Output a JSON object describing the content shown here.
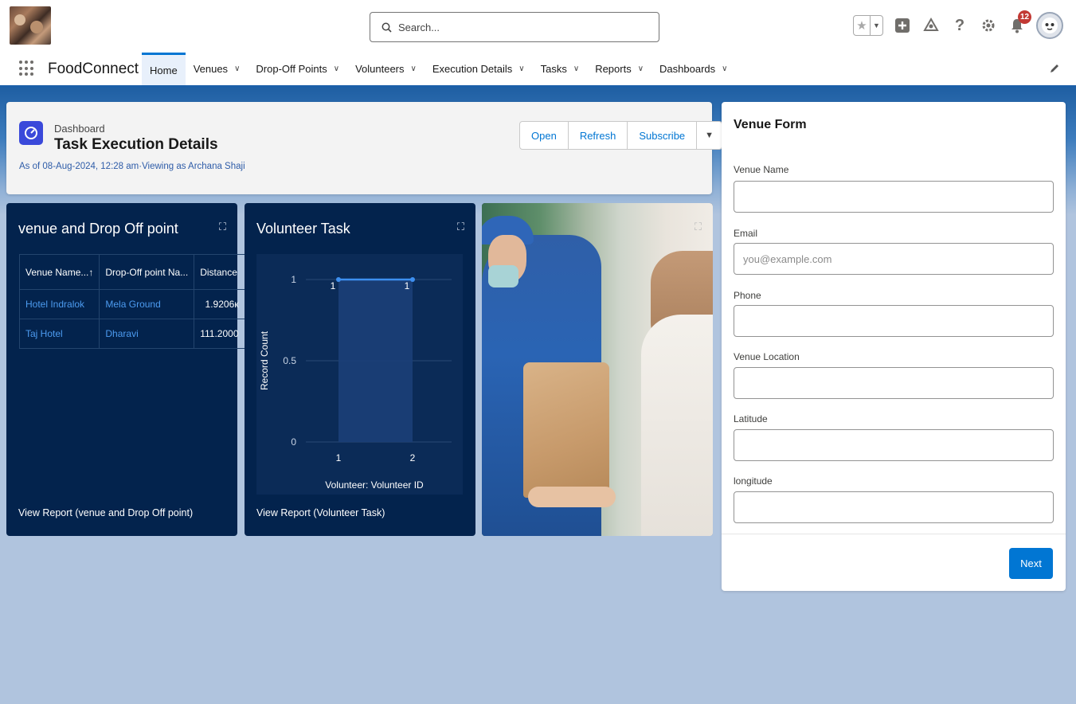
{
  "header": {
    "search_placeholder": "Search...",
    "notification_count": "12"
  },
  "nav": {
    "app_name": "FoodConnect",
    "tabs": [
      {
        "label": "Home",
        "active": true
      },
      {
        "label": "Venues"
      },
      {
        "label": "Drop-Off Points"
      },
      {
        "label": "Volunteers"
      },
      {
        "label": "Execution Details"
      },
      {
        "label": "Tasks"
      },
      {
        "label": "Reports"
      },
      {
        "label": "Dashboards"
      }
    ]
  },
  "dashboard": {
    "type_label": "Dashboard",
    "title": "Task Execution Details",
    "subtitle": "As of 08-Aug-2024, 12:28 am·Viewing as Archana Shaji",
    "buttons": {
      "open": "Open",
      "refresh": "Refresh",
      "subscribe": "Subscribe"
    }
  },
  "widget1": {
    "title": "venue and Drop Off point",
    "columns": [
      "Venue Name...↑",
      "Drop-Off point Na...",
      "Distance"
    ],
    "rows": [
      [
        "Hotel Indralok",
        "Mela Ground",
        "1.9206к"
      ],
      [
        "Taj Hotel",
        "Dharavi",
        "111.2000"
      ]
    ],
    "footer": "View Report (venue and Drop Off point)"
  },
  "widget2": {
    "title": "Volunteer Task",
    "footer": "View Report (Volunteer Task)"
  },
  "chart_data": {
    "type": "line",
    "x": [
      "1",
      "2"
    ],
    "series": [
      {
        "values": [
          1,
          1
        ]
      }
    ],
    "xlabel": "Volunteer: Volunteer ID",
    "ylabel": "Record Count",
    "yticks": [
      "0",
      "0.5",
      "1"
    ],
    "ylim": [
      0,
      1
    ],
    "data_labels": [
      "1",
      "1"
    ],
    "grid": true,
    "area_fill": true
  },
  "form": {
    "title": "Venue Form",
    "fields": [
      {
        "label": "Venue Name",
        "placeholder": ""
      },
      {
        "label": "Email",
        "placeholder": "you@example.com"
      },
      {
        "label": "Phone",
        "placeholder": ""
      },
      {
        "label": "Venue Location",
        "placeholder": ""
      },
      {
        "label": "Latitude",
        "placeholder": ""
      },
      {
        "label": "longitude",
        "placeholder": ""
      }
    ],
    "next_label": "Next"
  },
  "colors": {
    "brand_blue": "#0176d3",
    "widget_bg": "#03234d",
    "link_blue": "#4c9bf0"
  }
}
